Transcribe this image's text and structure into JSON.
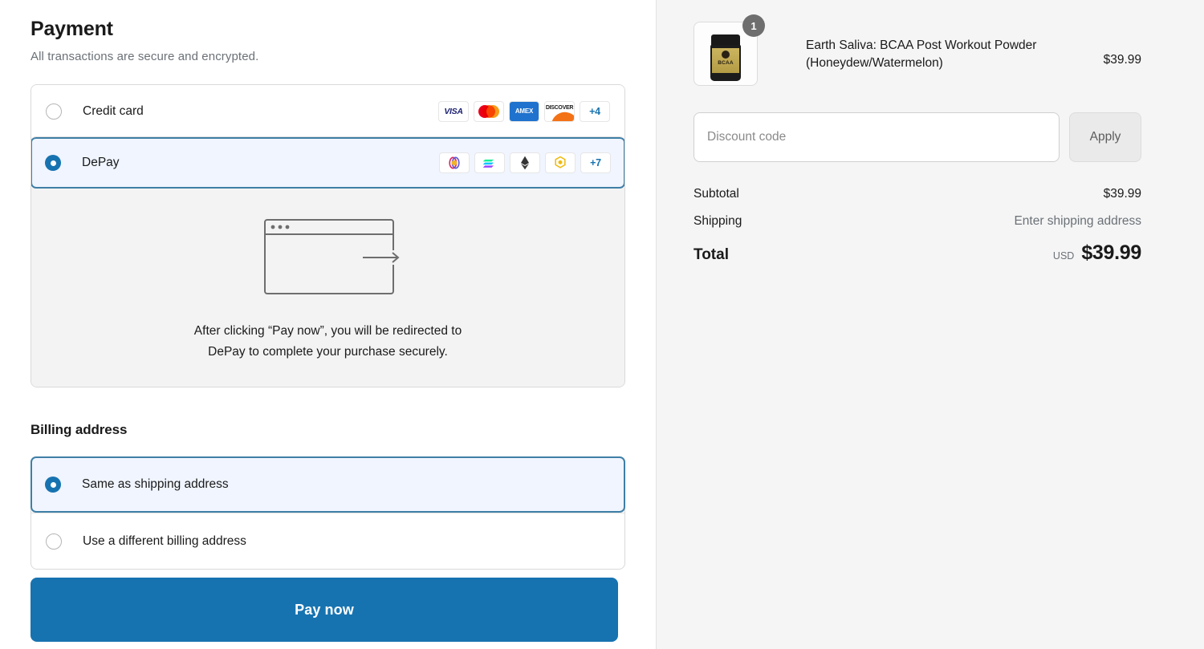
{
  "payment": {
    "heading": "Payment",
    "subheading": "All transactions are secure and encrypted.",
    "methods": [
      {
        "id": "credit-card",
        "label": "Credit card",
        "selected": false,
        "brands": [
          "visa-icon",
          "mastercard-icon",
          "amex-icon",
          "discover-icon"
        ],
        "more_label": "+4"
      },
      {
        "id": "depay",
        "label": "DePay",
        "selected": true,
        "brands": [
          "polygon-icon",
          "solana-icon",
          "ethereum-icon",
          "bnb-icon"
        ],
        "more_label": "+7"
      }
    ],
    "redirect_notice_line1": "After clicking “Pay now”, you will be redirected to",
    "redirect_notice_line2": "DePay to complete your purchase securely."
  },
  "billing": {
    "heading": "Billing address",
    "options": [
      {
        "id": "same-as-shipping",
        "label": "Same as shipping address",
        "selected": true
      },
      {
        "id": "different-billing",
        "label": "Use a different billing address",
        "selected": false
      }
    ]
  },
  "actions": {
    "pay_now_label": "Pay now"
  },
  "summary": {
    "item": {
      "name_line1": "Earth Saliva: BCAA Post Workout Powder",
      "name_line2": "(Honeydew/Watermelon)",
      "price": "$39.99",
      "quantity": "1",
      "thumb_label": "BCAA"
    },
    "discount": {
      "placeholder": "Discount code",
      "value": "",
      "apply_label": "Apply"
    },
    "rows": [
      {
        "label": "Subtotal",
        "value": "$39.99",
        "muted": false
      },
      {
        "label": "Shipping",
        "value": "Enter shipping address",
        "muted": true
      }
    ],
    "total": {
      "label": "Total",
      "currency": "USD",
      "amount": "$39.99"
    }
  },
  "colors": {
    "accent": "#1773b0",
    "selected_bg": "#f0f5ff",
    "selected_border": "#3f7fa6",
    "panel_bg": "#f3f3f3",
    "sidebar_bg": "#f5f5f5"
  }
}
